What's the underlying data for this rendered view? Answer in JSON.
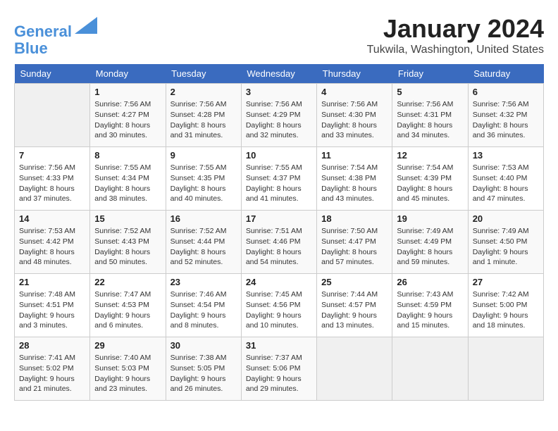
{
  "header": {
    "logo_line1": "General",
    "logo_line2": "Blue",
    "month_title": "January 2024",
    "location": "Tukwila, Washington, United States"
  },
  "weekdays": [
    "Sunday",
    "Monday",
    "Tuesday",
    "Wednesday",
    "Thursday",
    "Friday",
    "Saturday"
  ],
  "weeks": [
    [
      {
        "day": "",
        "info": ""
      },
      {
        "day": "1",
        "info": "Sunrise: 7:56 AM\nSunset: 4:27 PM\nDaylight: 8 hours\nand 30 minutes."
      },
      {
        "day": "2",
        "info": "Sunrise: 7:56 AM\nSunset: 4:28 PM\nDaylight: 8 hours\nand 31 minutes."
      },
      {
        "day": "3",
        "info": "Sunrise: 7:56 AM\nSunset: 4:29 PM\nDaylight: 8 hours\nand 32 minutes."
      },
      {
        "day": "4",
        "info": "Sunrise: 7:56 AM\nSunset: 4:30 PM\nDaylight: 8 hours\nand 33 minutes."
      },
      {
        "day": "5",
        "info": "Sunrise: 7:56 AM\nSunset: 4:31 PM\nDaylight: 8 hours\nand 34 minutes."
      },
      {
        "day": "6",
        "info": "Sunrise: 7:56 AM\nSunset: 4:32 PM\nDaylight: 8 hours\nand 36 minutes."
      }
    ],
    [
      {
        "day": "7",
        "info": "Sunrise: 7:56 AM\nSunset: 4:33 PM\nDaylight: 8 hours\nand 37 minutes."
      },
      {
        "day": "8",
        "info": "Sunrise: 7:55 AM\nSunset: 4:34 PM\nDaylight: 8 hours\nand 38 minutes."
      },
      {
        "day": "9",
        "info": "Sunrise: 7:55 AM\nSunset: 4:35 PM\nDaylight: 8 hours\nand 40 minutes."
      },
      {
        "day": "10",
        "info": "Sunrise: 7:55 AM\nSunset: 4:37 PM\nDaylight: 8 hours\nand 41 minutes."
      },
      {
        "day": "11",
        "info": "Sunrise: 7:54 AM\nSunset: 4:38 PM\nDaylight: 8 hours\nand 43 minutes."
      },
      {
        "day": "12",
        "info": "Sunrise: 7:54 AM\nSunset: 4:39 PM\nDaylight: 8 hours\nand 45 minutes."
      },
      {
        "day": "13",
        "info": "Sunrise: 7:53 AM\nSunset: 4:40 PM\nDaylight: 8 hours\nand 47 minutes."
      }
    ],
    [
      {
        "day": "14",
        "info": "Sunrise: 7:53 AM\nSunset: 4:42 PM\nDaylight: 8 hours\nand 48 minutes."
      },
      {
        "day": "15",
        "info": "Sunrise: 7:52 AM\nSunset: 4:43 PM\nDaylight: 8 hours\nand 50 minutes."
      },
      {
        "day": "16",
        "info": "Sunrise: 7:52 AM\nSunset: 4:44 PM\nDaylight: 8 hours\nand 52 minutes."
      },
      {
        "day": "17",
        "info": "Sunrise: 7:51 AM\nSunset: 4:46 PM\nDaylight: 8 hours\nand 54 minutes."
      },
      {
        "day": "18",
        "info": "Sunrise: 7:50 AM\nSunset: 4:47 PM\nDaylight: 8 hours\nand 57 minutes."
      },
      {
        "day": "19",
        "info": "Sunrise: 7:49 AM\nSunset: 4:49 PM\nDaylight: 8 hours\nand 59 minutes."
      },
      {
        "day": "20",
        "info": "Sunrise: 7:49 AM\nSunset: 4:50 PM\nDaylight: 9 hours\nand 1 minute."
      }
    ],
    [
      {
        "day": "21",
        "info": "Sunrise: 7:48 AM\nSunset: 4:51 PM\nDaylight: 9 hours\nand 3 minutes."
      },
      {
        "day": "22",
        "info": "Sunrise: 7:47 AM\nSunset: 4:53 PM\nDaylight: 9 hours\nand 6 minutes."
      },
      {
        "day": "23",
        "info": "Sunrise: 7:46 AM\nSunset: 4:54 PM\nDaylight: 9 hours\nand 8 minutes."
      },
      {
        "day": "24",
        "info": "Sunrise: 7:45 AM\nSunset: 4:56 PM\nDaylight: 9 hours\nand 10 minutes."
      },
      {
        "day": "25",
        "info": "Sunrise: 7:44 AM\nSunset: 4:57 PM\nDaylight: 9 hours\nand 13 minutes."
      },
      {
        "day": "26",
        "info": "Sunrise: 7:43 AM\nSunset: 4:59 PM\nDaylight: 9 hours\nand 15 minutes."
      },
      {
        "day": "27",
        "info": "Sunrise: 7:42 AM\nSunset: 5:00 PM\nDaylight: 9 hours\nand 18 minutes."
      }
    ],
    [
      {
        "day": "28",
        "info": "Sunrise: 7:41 AM\nSunset: 5:02 PM\nDaylight: 9 hours\nand 21 minutes."
      },
      {
        "day": "29",
        "info": "Sunrise: 7:40 AM\nSunset: 5:03 PM\nDaylight: 9 hours\nand 23 minutes."
      },
      {
        "day": "30",
        "info": "Sunrise: 7:38 AM\nSunset: 5:05 PM\nDaylight: 9 hours\nand 26 minutes."
      },
      {
        "day": "31",
        "info": "Sunrise: 7:37 AM\nSunset: 5:06 PM\nDaylight: 9 hours\nand 29 minutes."
      },
      {
        "day": "",
        "info": ""
      },
      {
        "day": "",
        "info": ""
      },
      {
        "day": "",
        "info": ""
      }
    ]
  ]
}
